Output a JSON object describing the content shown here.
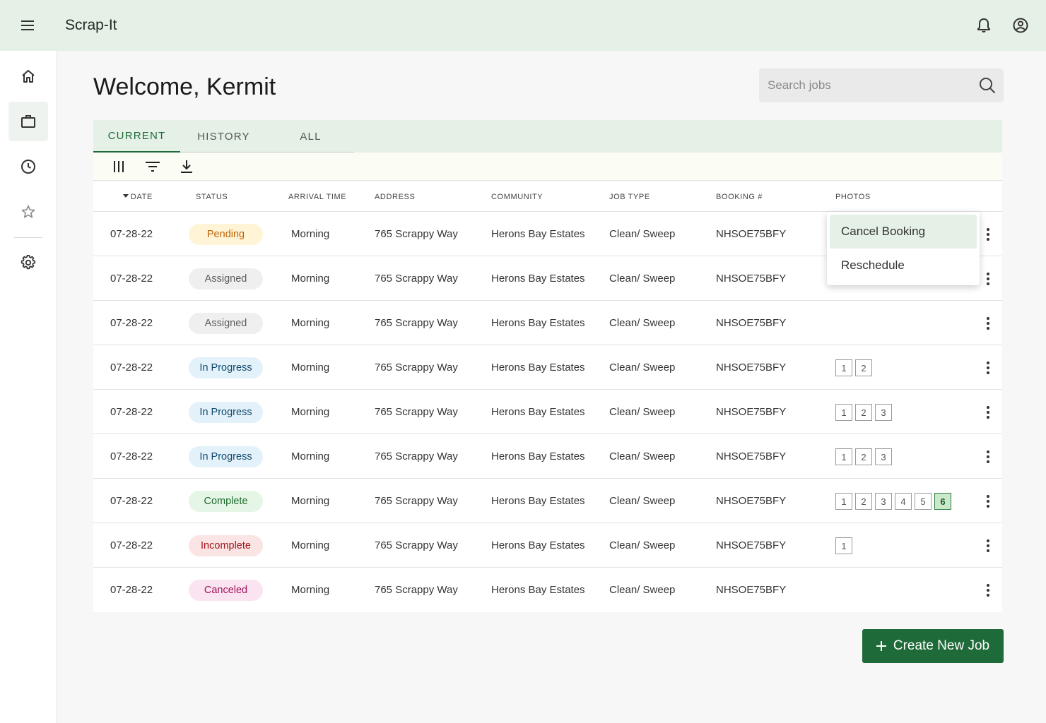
{
  "app": {
    "title": "Scrap-It"
  },
  "header": {
    "welcome": "Welcome, Kermit"
  },
  "search": {
    "placeholder": "Search jobs"
  },
  "tabs": [
    {
      "label": "CURRENT",
      "active": true
    },
    {
      "label": "HISTORY",
      "active": false
    },
    {
      "label": "ALL",
      "active": false
    }
  ],
  "table": {
    "sort_column": "date",
    "sort_direction": "desc",
    "columns": {
      "date": "Date",
      "status": "Status",
      "arrival": "Arrival Time",
      "address": "Address",
      "community": "Community",
      "job_type": "Job Type",
      "booking": "Booking #",
      "photos": "Photos"
    },
    "rows": [
      {
        "date": "07-28-22",
        "status": "Pending",
        "status_key": "pending",
        "arrival": "Morning",
        "address": "765 Scrappy Way",
        "community": "Herons Bay Estates",
        "job_type": "Clean/ Sweep",
        "booking": "NHSOE75BFY",
        "photos": []
      },
      {
        "date": "07-28-22",
        "status": "Assigned",
        "status_key": "assigned",
        "arrival": "Morning",
        "address": "765 Scrappy Way",
        "community": "Herons Bay Estates",
        "job_type": "Clean/ Sweep",
        "booking": "NHSOE75BFY",
        "photos": []
      },
      {
        "date": "07-28-22",
        "status": "Assigned",
        "status_key": "assigned",
        "arrival": "Morning",
        "address": "765 Scrappy Way",
        "community": "Herons Bay Estates",
        "job_type": "Clean/ Sweep",
        "booking": "NHSOE75BFY",
        "photos": []
      },
      {
        "date": "07-28-22",
        "status": "In Progress",
        "status_key": "inprogress",
        "arrival": "Morning",
        "address": "765 Scrappy Way",
        "community": "Herons Bay Estates",
        "job_type": "Clean/ Sweep",
        "booking": "NHSOE75BFY",
        "photos": [
          "1",
          "2"
        ]
      },
      {
        "date": "07-28-22",
        "status": "In Progress",
        "status_key": "inprogress",
        "arrival": "Morning",
        "address": "765 Scrappy Way",
        "community": "Herons Bay Estates",
        "job_type": "Clean/ Sweep",
        "booking": "NHSOE75BFY",
        "photos": [
          "1",
          "2",
          "3"
        ]
      },
      {
        "date": "07-28-22",
        "status": "In Progress",
        "status_key": "inprogress",
        "arrival": "Morning",
        "address": "765 Scrappy Way",
        "community": "Herons Bay Estates",
        "job_type": "Clean/ Sweep",
        "booking": "NHSOE75BFY",
        "photos": [
          "1",
          "2",
          "3"
        ]
      },
      {
        "date": "07-28-22",
        "status": "Complete",
        "status_key": "complete",
        "arrival": "Morning",
        "address": "765 Scrappy Way",
        "community": "Herons Bay Estates",
        "job_type": "Clean/ Sweep",
        "booking": "NHSOE75BFY",
        "photos": [
          "1",
          "2",
          "3",
          "4",
          "5",
          "6"
        ],
        "photo_selected": "6"
      },
      {
        "date": "07-28-22",
        "status": "Incomplete",
        "status_key": "incomplete",
        "arrival": "Morning",
        "address": "765 Scrappy Way",
        "community": "Herons Bay Estates",
        "job_type": "Clean/ Sweep",
        "booking": "NHSOE75BFY",
        "photos": [
          "1"
        ]
      },
      {
        "date": "07-28-22",
        "status": "Canceled",
        "status_key": "canceled",
        "arrival": "Morning",
        "address": "765 Scrappy Way",
        "community": "Herons Bay Estates",
        "job_type": "Clean/ Sweep",
        "booking": "NHSOE75BFY",
        "photos": []
      }
    ]
  },
  "context_menu": {
    "items": [
      {
        "label": "Cancel Booking",
        "highlighted": true
      },
      {
        "label": "Reschedule",
        "highlighted": false
      }
    ]
  },
  "create_button": {
    "icon": "plus-icon",
    "label": "Create New Job"
  },
  "icons": {
    "topbar": [
      "menu-icon",
      "bell-icon",
      "account-circle-icon"
    ],
    "sidebar": [
      "home-icon",
      "briefcase-icon",
      "clock-icon",
      "star-icon",
      "gear-icon"
    ],
    "toolbar": [
      "columns-icon",
      "filter-icon",
      "download-icon"
    ]
  },
  "colors": {
    "brand_green": "#1e6b39",
    "topbar_bg": "#e5f0e6",
    "pending": "#c0620a",
    "assigned": "#5c5c5c",
    "in_progress": "#114a6b",
    "complete": "#1c6a2c",
    "incomplete": "#a4151c",
    "canceled": "#a0135c"
  }
}
